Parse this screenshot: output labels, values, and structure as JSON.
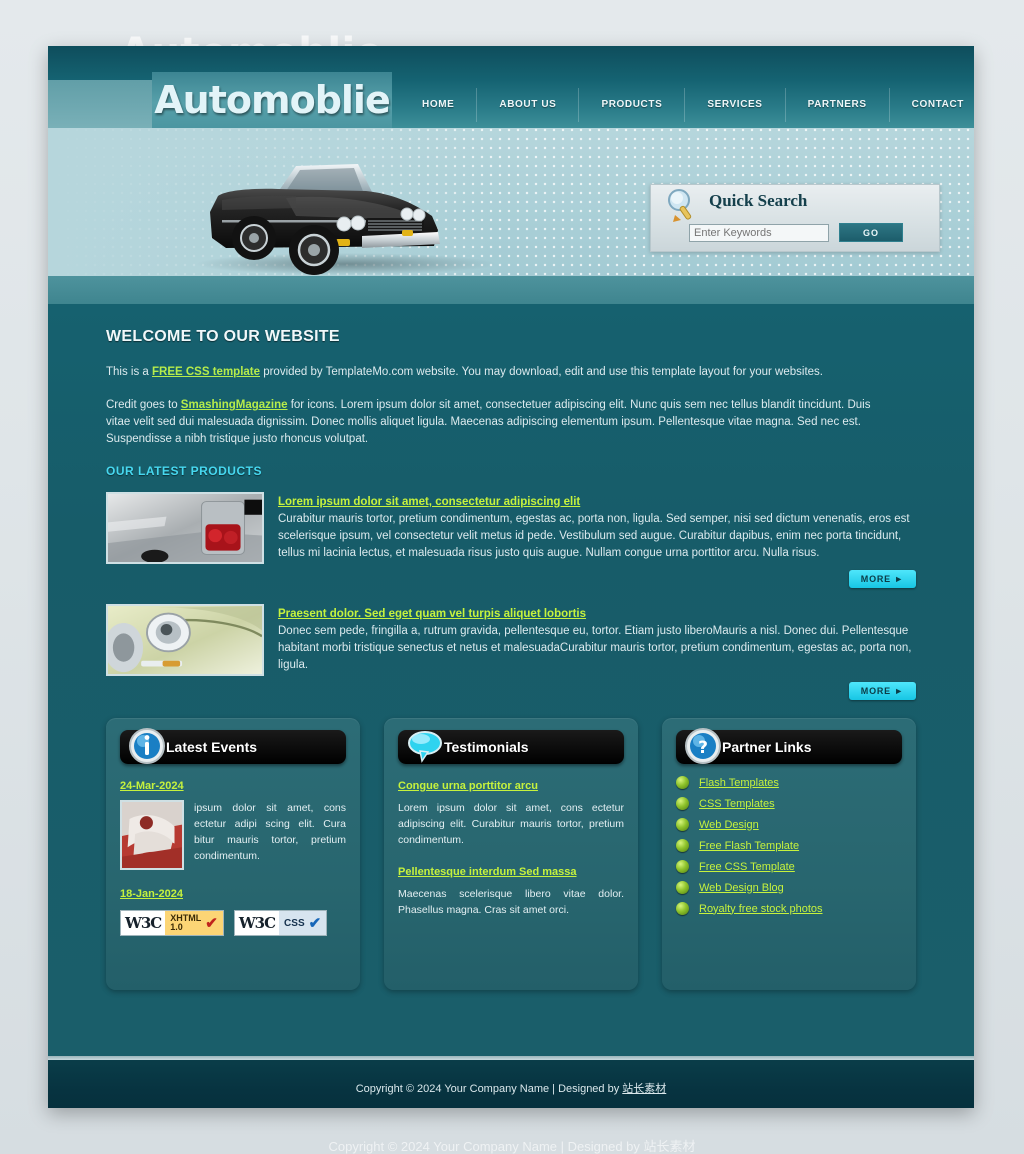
{
  "site": {
    "logo": "Automoblie",
    "ghost_title": "Automoblie"
  },
  "nav": {
    "items": [
      {
        "label": "HOME"
      },
      {
        "label": "ABOUT US"
      },
      {
        "label": "PRODUCTS"
      },
      {
        "label": "SERVICES"
      },
      {
        "label": "PARTNERS"
      },
      {
        "label": "CONTACT"
      }
    ]
  },
  "quick_search": {
    "title": "Quick Search",
    "placeholder": "Enter Keywords",
    "value": "",
    "button": "GO"
  },
  "welcome": {
    "heading": "WELCOME TO OUR WEBSITE",
    "p1_pre": "This is a ",
    "p1_link": "FREE CSS template",
    "p1_post": " provided by TemplateMo.com website. You may download, edit and use this template layout for your websites.",
    "p2_pre": "Credit goes to ",
    "p2_link": "SmashingMagazine",
    "p2_post": " for icons. Lorem ipsum dolor sit amet, consectetuer adipiscing elit. Nunc quis sem nec tellus blandit tincidunt. Duis vitae velit sed dui malesuada dignissim. Donec mollis aliquet ligula. Maecenas adipiscing elementum ipsum. Pellentesque vitae magna. Sed nec est. Suspendisse a nibh tristique justo rhoncus volutpat."
  },
  "products": {
    "heading": "OUR LATEST PRODUCTS",
    "more_label": "MORE ►",
    "items": [
      {
        "title": "Lorem ipsum dolor sit amet, consectetur adipiscing elit",
        "text": "Curabitur mauris tortor, pretium condimentum, egestas ac, porta non, ligula. Sed semper, nisi sed dictum venenatis, eros est scelerisque ipsum, vel consectetur velit metus id pede. Vestibulum sed augue. Curabitur dapibus, enim nec porta tincidunt, tellus mi lacinia lectus, et malesuada risus justo quis augue. Nullam congue urna porttitor arcu. Nulla risus.",
        "thumb": "taillight-photo"
      },
      {
        "title": "Praesent dolor. Sed eget quam vel turpis aliquet lobortis",
        "text": "Donec sem pede, fringilla a, rutrum gravida, pellentesque eu, tortor. Etiam justo liberoMauris a nisl. Donec dui. Pellentesque habitant morbi tristique senectus et netus et malesuadaCurabitur mauris tortor, pretium condimentum, egestas ac, porta non, ligula.",
        "thumb": "headlight-photo"
      }
    ]
  },
  "latest_events": {
    "title": "Latest Events",
    "icon": "info-icon",
    "events": [
      {
        "date": "24-Mar-2024",
        "text": "ipsum dolor sit amet, cons ectetur adipi scing elit. Cura bitur mauris tortor, pretium condimentum.",
        "thumb": "car-interior-photo"
      },
      {
        "date": "18-Jan-2024",
        "text": "",
        "thumb": ""
      }
    ],
    "badges": [
      {
        "mark": "W3C",
        "label_line1": "XHTML",
        "label_line2": "1.0",
        "tick": "✔",
        "style": "xhtml"
      },
      {
        "mark": "W3C",
        "label_line1": "CSS",
        "label_line2": "",
        "tick": "✔",
        "style": "css"
      }
    ]
  },
  "testimonials": {
    "title": "Testimonials",
    "icon": "speech-bubble-icon",
    "items": [
      {
        "title": "Congue urna porttitor arcu",
        "text": "Lorem ipsum dolor sit amet, cons ectetur adipiscing elit. Curabitur mauris tortor, pretium condimentum."
      },
      {
        "title": "Pellentesque interdum Sed massa",
        "text": "Maecenas scelerisque libero vitae dolor. Phasellus magna. Cras sit amet orci."
      }
    ]
  },
  "partner_links": {
    "title": "Partner Links",
    "icon": "question-mark-icon",
    "links": [
      {
        "label": "Flash Templates"
      },
      {
        "label": "CSS Templates"
      },
      {
        "label": "Web Design"
      },
      {
        "label": "Free Flash Template"
      },
      {
        "label": "Free CSS Template"
      },
      {
        "label": "Web Design Blog"
      },
      {
        "label": "Royalty free stock photos"
      }
    ]
  },
  "footer": {
    "text_pre": "Copyright © 2024 Your Company Name | Designed by ",
    "link": "站长素材",
    "ghost": "Copyright © 2024 Your Company Name | Designed by 站长素材"
  },
  "colors": {
    "accent_cyan": "#47d8f0",
    "link_green": "#c6f23d",
    "page_teal": "#175c69",
    "header_teal": "#156372",
    "footer_dark": "#073340"
  }
}
